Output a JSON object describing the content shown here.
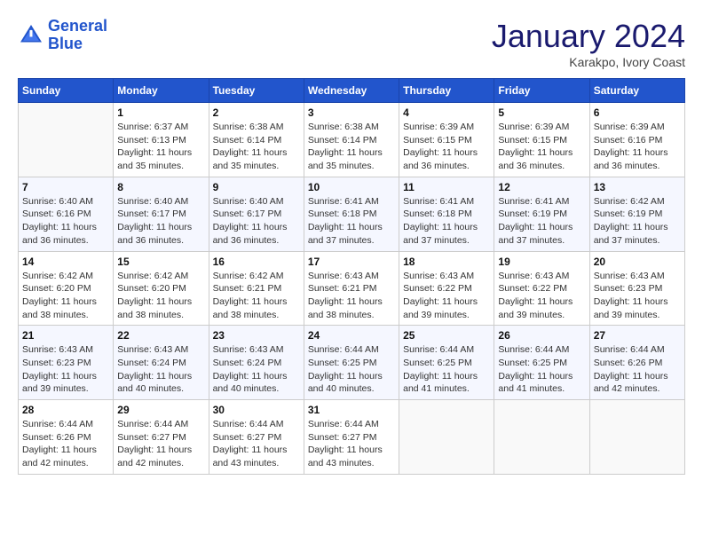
{
  "header": {
    "logo_line1": "General",
    "logo_line2": "Blue",
    "month": "January 2024",
    "location": "Karakpo, Ivory Coast"
  },
  "weekdays": [
    "Sunday",
    "Monday",
    "Tuesday",
    "Wednesday",
    "Thursday",
    "Friday",
    "Saturday"
  ],
  "weeks": [
    [
      {
        "day": "",
        "info": ""
      },
      {
        "day": "1",
        "info": "Sunrise: 6:37 AM\nSunset: 6:13 PM\nDaylight: 11 hours\nand 35 minutes."
      },
      {
        "day": "2",
        "info": "Sunrise: 6:38 AM\nSunset: 6:14 PM\nDaylight: 11 hours\nand 35 minutes."
      },
      {
        "day": "3",
        "info": "Sunrise: 6:38 AM\nSunset: 6:14 PM\nDaylight: 11 hours\nand 35 minutes."
      },
      {
        "day": "4",
        "info": "Sunrise: 6:39 AM\nSunset: 6:15 PM\nDaylight: 11 hours\nand 36 minutes."
      },
      {
        "day": "5",
        "info": "Sunrise: 6:39 AM\nSunset: 6:15 PM\nDaylight: 11 hours\nand 36 minutes."
      },
      {
        "day": "6",
        "info": "Sunrise: 6:39 AM\nSunset: 6:16 PM\nDaylight: 11 hours\nand 36 minutes."
      }
    ],
    [
      {
        "day": "7",
        "info": "Sunrise: 6:40 AM\nSunset: 6:16 PM\nDaylight: 11 hours\nand 36 minutes."
      },
      {
        "day": "8",
        "info": "Sunrise: 6:40 AM\nSunset: 6:17 PM\nDaylight: 11 hours\nand 36 minutes."
      },
      {
        "day": "9",
        "info": "Sunrise: 6:40 AM\nSunset: 6:17 PM\nDaylight: 11 hours\nand 36 minutes."
      },
      {
        "day": "10",
        "info": "Sunrise: 6:41 AM\nSunset: 6:18 PM\nDaylight: 11 hours\nand 37 minutes."
      },
      {
        "day": "11",
        "info": "Sunrise: 6:41 AM\nSunset: 6:18 PM\nDaylight: 11 hours\nand 37 minutes."
      },
      {
        "day": "12",
        "info": "Sunrise: 6:41 AM\nSunset: 6:19 PM\nDaylight: 11 hours\nand 37 minutes."
      },
      {
        "day": "13",
        "info": "Sunrise: 6:42 AM\nSunset: 6:19 PM\nDaylight: 11 hours\nand 37 minutes."
      }
    ],
    [
      {
        "day": "14",
        "info": "Sunrise: 6:42 AM\nSunset: 6:20 PM\nDaylight: 11 hours\nand 38 minutes."
      },
      {
        "day": "15",
        "info": "Sunrise: 6:42 AM\nSunset: 6:20 PM\nDaylight: 11 hours\nand 38 minutes."
      },
      {
        "day": "16",
        "info": "Sunrise: 6:42 AM\nSunset: 6:21 PM\nDaylight: 11 hours\nand 38 minutes."
      },
      {
        "day": "17",
        "info": "Sunrise: 6:43 AM\nSunset: 6:21 PM\nDaylight: 11 hours\nand 38 minutes."
      },
      {
        "day": "18",
        "info": "Sunrise: 6:43 AM\nSunset: 6:22 PM\nDaylight: 11 hours\nand 39 minutes."
      },
      {
        "day": "19",
        "info": "Sunrise: 6:43 AM\nSunset: 6:22 PM\nDaylight: 11 hours\nand 39 minutes."
      },
      {
        "day": "20",
        "info": "Sunrise: 6:43 AM\nSunset: 6:23 PM\nDaylight: 11 hours\nand 39 minutes."
      }
    ],
    [
      {
        "day": "21",
        "info": "Sunrise: 6:43 AM\nSunset: 6:23 PM\nDaylight: 11 hours\nand 39 minutes."
      },
      {
        "day": "22",
        "info": "Sunrise: 6:43 AM\nSunset: 6:24 PM\nDaylight: 11 hours\nand 40 minutes."
      },
      {
        "day": "23",
        "info": "Sunrise: 6:43 AM\nSunset: 6:24 PM\nDaylight: 11 hours\nand 40 minutes."
      },
      {
        "day": "24",
        "info": "Sunrise: 6:44 AM\nSunset: 6:25 PM\nDaylight: 11 hours\nand 40 minutes."
      },
      {
        "day": "25",
        "info": "Sunrise: 6:44 AM\nSunset: 6:25 PM\nDaylight: 11 hours\nand 41 minutes."
      },
      {
        "day": "26",
        "info": "Sunrise: 6:44 AM\nSunset: 6:25 PM\nDaylight: 11 hours\nand 41 minutes."
      },
      {
        "day": "27",
        "info": "Sunrise: 6:44 AM\nSunset: 6:26 PM\nDaylight: 11 hours\nand 42 minutes."
      }
    ],
    [
      {
        "day": "28",
        "info": "Sunrise: 6:44 AM\nSunset: 6:26 PM\nDaylight: 11 hours\nand 42 minutes."
      },
      {
        "day": "29",
        "info": "Sunrise: 6:44 AM\nSunset: 6:27 PM\nDaylight: 11 hours\nand 42 minutes."
      },
      {
        "day": "30",
        "info": "Sunrise: 6:44 AM\nSunset: 6:27 PM\nDaylight: 11 hours\nand 43 minutes."
      },
      {
        "day": "31",
        "info": "Sunrise: 6:44 AM\nSunset: 6:27 PM\nDaylight: 11 hours\nand 43 minutes."
      },
      {
        "day": "",
        "info": ""
      },
      {
        "day": "",
        "info": ""
      },
      {
        "day": "",
        "info": ""
      }
    ]
  ]
}
